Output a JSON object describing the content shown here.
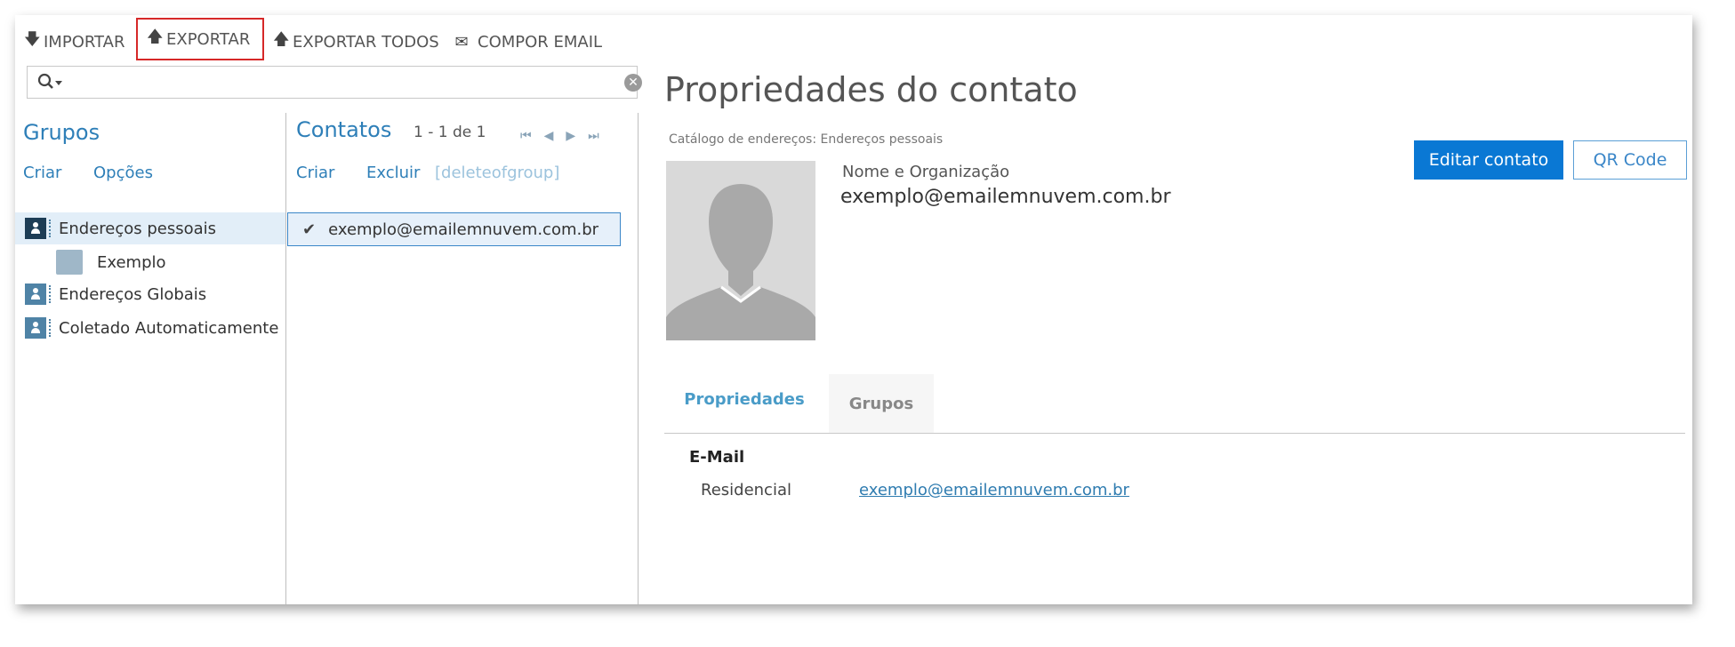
{
  "toolbar": {
    "import_label": "IMPORTAR",
    "export_label": "EXPORTAR",
    "export_all_label": "EXPORTAR TODOS",
    "compose_label": "COMPOR EMAIL"
  },
  "search": {
    "value": "",
    "placeholder": ""
  },
  "groups": {
    "title": "Grupos",
    "create": "Criar",
    "options": "Opções",
    "items": [
      {
        "label": "Endereços pessoais",
        "selected": true
      },
      {
        "label": "Exemplo"
      },
      {
        "label": "Endereços Globais"
      },
      {
        "label": "Coletado Automaticamente"
      }
    ]
  },
  "contacts": {
    "title": "Contatos",
    "count": "1 - 1 de 1",
    "create": "Criar",
    "delete": "Excluir",
    "delete_of_group": "[deleteofgroup]",
    "items": [
      {
        "label": "exemplo@emailemnuvem.com.br"
      }
    ]
  },
  "details": {
    "title": "Propriedades do contato",
    "catalog": "Catálogo de endereços: Endereços pessoais",
    "name_label": "Nome e Organização",
    "name_value": "exemplo@emailemnuvem.com.br",
    "edit_button": "Editar contato",
    "qr_button": "QR Code",
    "tabs": [
      {
        "label": "Propriedades",
        "active": true
      },
      {
        "label": "Grupos"
      }
    ],
    "section_title": "E-Mail",
    "field_label": "Residencial",
    "field_value": "exemplo@emailemnuvem.com.br"
  },
  "colors": {
    "accent": "#2e7fb8",
    "primary_button": "#0a78d4",
    "highlight": "#d62828"
  }
}
